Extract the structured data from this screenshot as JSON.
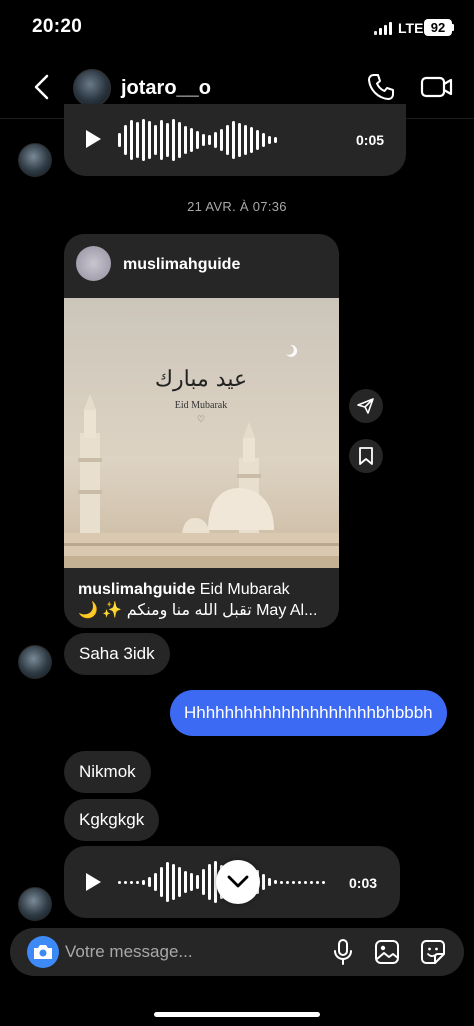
{
  "status_bar": {
    "time": "20:20",
    "network": "LTE",
    "battery": "92"
  },
  "header": {
    "username": "jotaro__o",
    "icons": [
      "back-icon",
      "phone-icon",
      "video-icon"
    ]
  },
  "messages": {
    "voice_top": {
      "duration": "0:05"
    },
    "timestamp": "21 AVR. À 07:36",
    "shared_post": {
      "username": "muslimahguide",
      "image_arabic": "عيد مبارك",
      "image_text": "Eid Mubarak",
      "caption_user": "muslimahguide",
      "caption_line1": " Eid Mubarak",
      "caption_line2": "🌙 ✨ تقبل الله منا ومنكم May Al..."
    },
    "received_1": "Saha 3idk",
    "sent_1": "Hhhhhhhhhhhhhhhhhhhhbhbbbh",
    "received_2": "Nikmok",
    "received_3": "Kgkgkgk",
    "voice_bottom": {
      "duration": "0:03"
    }
  },
  "composer": {
    "placeholder": "Votre message...",
    "icons": [
      "camera-icon",
      "microphone-icon",
      "gallery-icon",
      "sticker-icon"
    ]
  },
  "colors": {
    "background": "#000000",
    "bubble_received": "#262626",
    "bubble_sent": "#3d6af2",
    "camera_button": "#3d8af7"
  }
}
